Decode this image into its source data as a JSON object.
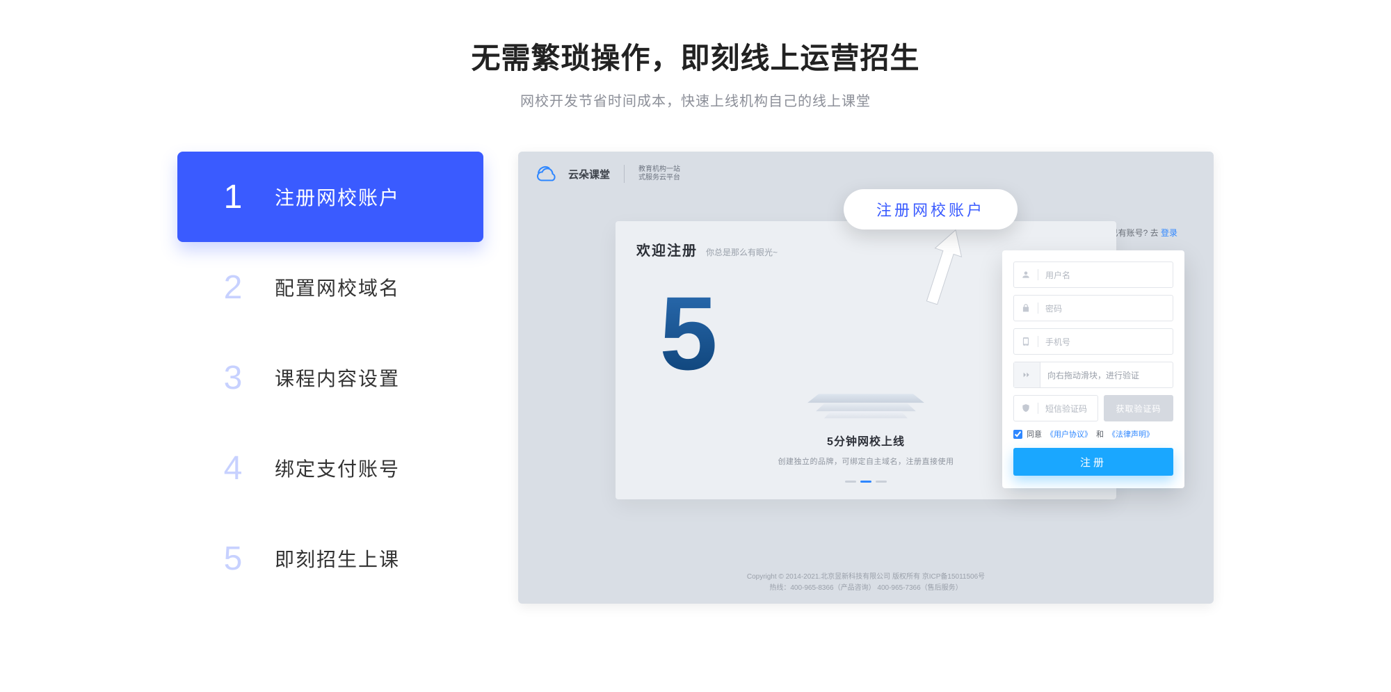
{
  "headline": {
    "title": "无需繁琐操作，即刻线上运营招生",
    "subtitle": "网校开发节省时间成本，快速上线机构自己的线上课堂"
  },
  "steps": [
    {
      "num": "1",
      "label": "注册网校账户",
      "active": true
    },
    {
      "num": "2",
      "label": "配置网校域名",
      "active": false
    },
    {
      "num": "3",
      "label": "课程内容设置",
      "active": false
    },
    {
      "num": "4",
      "label": "绑定支付账号",
      "active": false
    },
    {
      "num": "5",
      "label": "即刻招生上课",
      "active": false
    }
  ],
  "preview": {
    "logo_text": "云朵课堂",
    "logo_sub_line1": "教育机构一站",
    "logo_sub_line2": "式服务云平台",
    "callout": "注册网校账户",
    "welcome": "欢迎注册",
    "welcome_sub": "你总是那么有眼光~",
    "have_account_prefix": "已有账号? 去 ",
    "have_account_link": "登录",
    "big5_caption": "5分钟网校上线",
    "big5_desc": "创建独立的品牌，可绑定自主域名，注册直接使用",
    "footer_line1": "Copyright © 2014-2021.北京昱新科技有限公司 版权所有   京ICP备15011506号",
    "footer_line2": "热线：400-965-8366（产品咨询）  400-965-7366（售后服务）"
  },
  "form": {
    "username_placeholder": "用户名",
    "password_placeholder": "密码",
    "phone_placeholder": "手机号",
    "slider_text": "向右拖动滑块，进行验证",
    "code_placeholder": "短信验证码",
    "code_button": "获取验证码",
    "agree_prefix": "同意",
    "user_agreement": "《用户协议》",
    "agree_and": "和",
    "legal_statement": "《法律声明》",
    "submit": "注册"
  }
}
